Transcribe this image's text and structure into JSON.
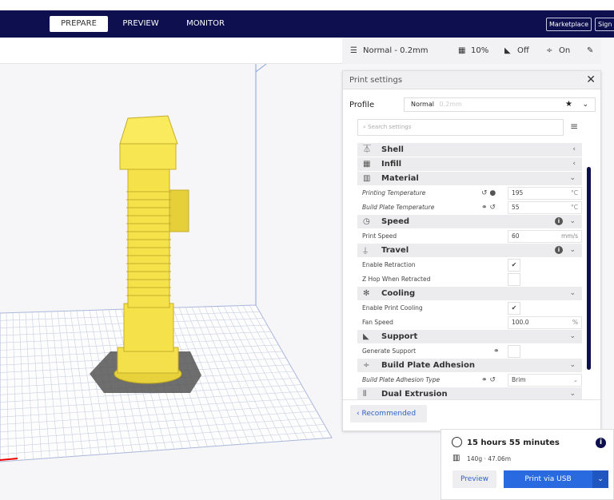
{
  "header": {
    "tabs": [
      {
        "label": "PREPARE"
      },
      {
        "label": "PREVIEW"
      },
      {
        "label": "MONITOR"
      }
    ],
    "marketplace": "Marketplace",
    "sign_in": "Sign in"
  },
  "summary": {
    "profile": "Normal - 0.2mm",
    "infill": "10%",
    "support": "Off",
    "adhesion": "On"
  },
  "print_settings": {
    "title": "Print settings",
    "profile_label": "Profile",
    "profile_value": "Normal",
    "profile_sub": "0.2mm",
    "search_placeholder": "Search settings",
    "categories": {
      "shell": "Shell",
      "infill": "Infill",
      "material": "Material",
      "speed": "Speed",
      "travel": "Travel",
      "cooling": "Cooling",
      "support": "Support",
      "adhesion": "Build Plate Adhesion",
      "dual": "Dual Extrusion"
    },
    "settings": {
      "print_temp": {
        "label": "Printing Temperature",
        "value": "195",
        "unit": "°C"
      },
      "bed_temp": {
        "label": "Build Plate Temperature",
        "value": "55",
        "unit": "°C"
      },
      "print_speed": {
        "label": "Print Speed",
        "value": "60",
        "unit": "mm/s"
      },
      "retraction": {
        "label": "Enable Retraction",
        "checked": true
      },
      "zhop": {
        "label": "Z Hop When Retracted",
        "checked": false
      },
      "cooling": {
        "label": "Enable Print Cooling",
        "checked": true
      },
      "fan_speed": {
        "label": "Fan Speed",
        "value": "100.0",
        "unit": "%"
      },
      "gen_support": {
        "label": "Generate Support",
        "checked": false
      },
      "adhesion_type": {
        "label": "Build Plate Adhesion Type",
        "value": "Brim"
      }
    },
    "recommended": "Recommended"
  },
  "job": {
    "time": "15 hours 55 minutes",
    "material": "140g · 47.06m",
    "preview": "Preview",
    "print": "Print via USB"
  },
  "colors": {
    "header": "#0e0f4f",
    "accent": "#2a6ae0",
    "model": "#f5e24a"
  }
}
